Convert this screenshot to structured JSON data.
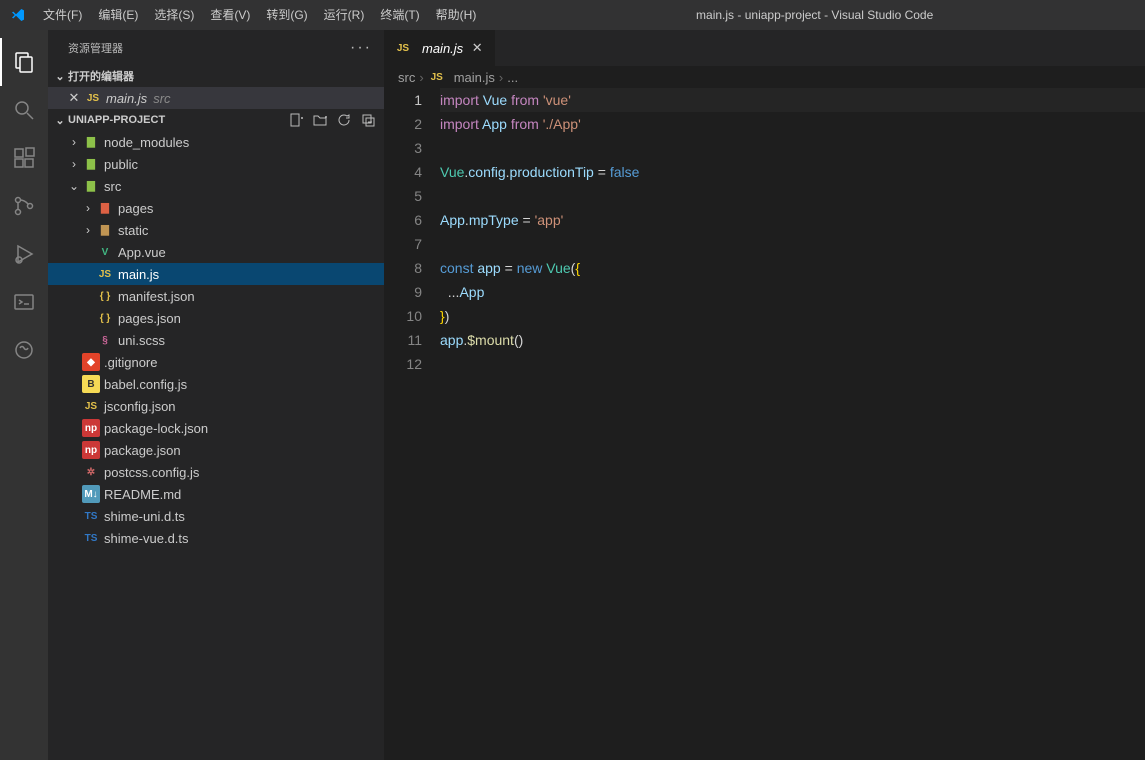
{
  "title": "main.js - uniapp-project - Visual Studio Code",
  "menu": [
    "文件(F)",
    "编辑(E)",
    "选择(S)",
    "查看(V)",
    "转到(G)",
    "运行(R)",
    "终端(T)",
    "帮助(H)"
  ],
  "sidebar": {
    "title": "资源管理器",
    "openEditorsLabel": "打开的编辑器",
    "projectName": "UNIAPP-PROJECT",
    "openFile": {
      "icon": "JS",
      "name": "main.js",
      "desc": "src"
    }
  },
  "tree": [
    {
      "type": "folder",
      "name": "node_modules",
      "indent": 1,
      "open": false,
      "iconColor": "#8dc149"
    },
    {
      "type": "folder",
      "name": "public",
      "indent": 1,
      "open": false,
      "iconColor": "#8dc149"
    },
    {
      "type": "folder",
      "name": "src",
      "indent": 1,
      "open": true,
      "iconColor": "#8dc149"
    },
    {
      "type": "folder",
      "name": "pages",
      "indent": 2,
      "open": false,
      "iconColor": "#dd6144"
    },
    {
      "type": "folder",
      "name": "static",
      "indent": 2,
      "open": false,
      "iconColor": "#c09553"
    },
    {
      "type": "file",
      "name": "App.vue",
      "indent": 2,
      "icon": "V",
      "iconBg": "",
      "iconColor": "#41b883"
    },
    {
      "type": "file",
      "name": "main.js",
      "indent": 2,
      "icon": "JS",
      "iconBg": "",
      "iconColor": "#e2c04b",
      "selected": true
    },
    {
      "type": "file",
      "name": "manifest.json",
      "indent": 2,
      "icon": "{ }",
      "iconBg": "",
      "iconColor": "#e2c04b"
    },
    {
      "type": "file",
      "name": "pages.json",
      "indent": 2,
      "icon": "{ }",
      "iconBg": "",
      "iconColor": "#e2c04b"
    },
    {
      "type": "file",
      "name": "uni.scss",
      "indent": 2,
      "icon": "§",
      "iconBg": "",
      "iconColor": "#cc6699"
    },
    {
      "type": "file",
      "name": ".gitignore",
      "indent": 1,
      "icon": "◆",
      "iconBg": "#e24329",
      "iconColor": "#ffffff"
    },
    {
      "type": "file",
      "name": "babel.config.js",
      "indent": 1,
      "icon": "B",
      "iconBg": "#f5da55",
      "iconColor": "#323330"
    },
    {
      "type": "file",
      "name": "jsconfig.json",
      "indent": 1,
      "icon": "JS",
      "iconBg": "",
      "iconColor": "#e2c04b"
    },
    {
      "type": "file",
      "name": "package-lock.json",
      "indent": 1,
      "icon": "np",
      "iconBg": "#cb3837",
      "iconColor": "#ffffff"
    },
    {
      "type": "file",
      "name": "package.json",
      "indent": 1,
      "icon": "np",
      "iconBg": "#cb3837",
      "iconColor": "#ffffff"
    },
    {
      "type": "file",
      "name": "postcss.config.js",
      "indent": 1,
      "icon": "✲",
      "iconBg": "",
      "iconColor": "#cc6666"
    },
    {
      "type": "file",
      "name": "README.md",
      "indent": 1,
      "icon": "M↓",
      "iconBg": "#519aba",
      "iconColor": "#ffffff"
    },
    {
      "type": "file",
      "name": "shime-uni.d.ts",
      "indent": 1,
      "icon": "TS",
      "iconBg": "",
      "iconColor": "#3178c6"
    },
    {
      "type": "file",
      "name": "shime-vue.d.ts",
      "indent": 1,
      "icon": "TS",
      "iconBg": "",
      "iconColor": "#3178c6"
    }
  ],
  "tab": {
    "icon": "JS",
    "name": "main.js"
  },
  "breadcrumbs": [
    {
      "text": "src"
    },
    {
      "icon": "JS",
      "text": "main.js"
    },
    {
      "text": "..."
    }
  ],
  "code": {
    "lines": [
      [
        {
          "c": "kw-import",
          "t": "import"
        },
        {
          "c": "punc",
          "t": " "
        },
        {
          "c": "ident",
          "t": "Vue"
        },
        {
          "c": "punc",
          "t": " "
        },
        {
          "c": "kw-from",
          "t": "from"
        },
        {
          "c": "punc",
          "t": " "
        },
        {
          "c": "str",
          "t": "'vue'"
        }
      ],
      [
        {
          "c": "kw-import",
          "t": "import"
        },
        {
          "c": "punc",
          "t": " "
        },
        {
          "c": "ident",
          "t": "App"
        },
        {
          "c": "punc",
          "t": " "
        },
        {
          "c": "kw-from",
          "t": "from"
        },
        {
          "c": "punc",
          "t": " "
        },
        {
          "c": "str",
          "t": "'./App'"
        }
      ],
      [],
      [
        {
          "c": "cls",
          "t": "Vue"
        },
        {
          "c": "punc",
          "t": "."
        },
        {
          "c": "prop",
          "t": "config"
        },
        {
          "c": "punc",
          "t": "."
        },
        {
          "c": "prop",
          "t": "productionTip"
        },
        {
          "c": "punc",
          "t": " "
        },
        {
          "c": "op",
          "t": "="
        },
        {
          "c": "punc",
          "t": " "
        },
        {
          "c": "kw-false",
          "t": "false"
        }
      ],
      [],
      [
        {
          "c": "ident",
          "t": "App"
        },
        {
          "c": "punc",
          "t": "."
        },
        {
          "c": "prop",
          "t": "mpType"
        },
        {
          "c": "punc",
          "t": " "
        },
        {
          "c": "op",
          "t": "="
        },
        {
          "c": "punc",
          "t": " "
        },
        {
          "c": "str",
          "t": "'app'"
        }
      ],
      [],
      [
        {
          "c": "kw-const",
          "t": "const"
        },
        {
          "c": "punc",
          "t": " "
        },
        {
          "c": "ident",
          "t": "app"
        },
        {
          "c": "punc",
          "t": " "
        },
        {
          "c": "op",
          "t": "="
        },
        {
          "c": "punc",
          "t": " "
        },
        {
          "c": "kw-new",
          "t": "new"
        },
        {
          "c": "punc",
          "t": " "
        },
        {
          "c": "cls",
          "t": "Vue"
        },
        {
          "c": "punc",
          "t": "("
        },
        {
          "c": "brace",
          "t": "{"
        }
      ],
      [
        {
          "c": "punc",
          "t": "  ..."
        },
        {
          "c": "ident",
          "t": "App"
        }
      ],
      [
        {
          "c": "brace",
          "t": "}"
        },
        {
          "c": "punc",
          "t": ")"
        }
      ],
      [
        {
          "c": "ident",
          "t": "app"
        },
        {
          "c": "punc",
          "t": "."
        },
        {
          "c": "fn",
          "t": "$mount"
        },
        {
          "c": "punc",
          "t": "()"
        }
      ],
      []
    ],
    "currentLine": 1
  }
}
